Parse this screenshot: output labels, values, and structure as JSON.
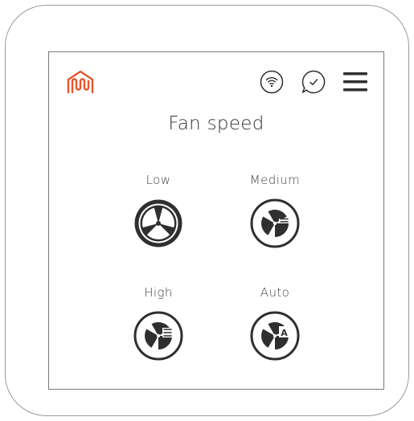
{
  "screen": {
    "title": "Fan speed",
    "options": [
      {
        "id": "low",
        "label": "Low",
        "selected": true
      },
      {
        "id": "medium",
        "label": "Medium",
        "selected": false
      },
      {
        "id": "high",
        "label": "High",
        "selected": false
      },
      {
        "id": "auto",
        "label": "Auto",
        "selected": false
      }
    ],
    "auto_badge": "A"
  },
  "colors": {
    "brand": "#e8552b",
    "icon": "#2f2f2f",
    "frame": "#9a9a9a"
  },
  "icons": {
    "logo": "house-waves-logo-icon",
    "wifi": "wifi-icon",
    "chat": "chat-check-icon",
    "menu": "hamburger-menu-icon",
    "fan": "fan-icon"
  }
}
